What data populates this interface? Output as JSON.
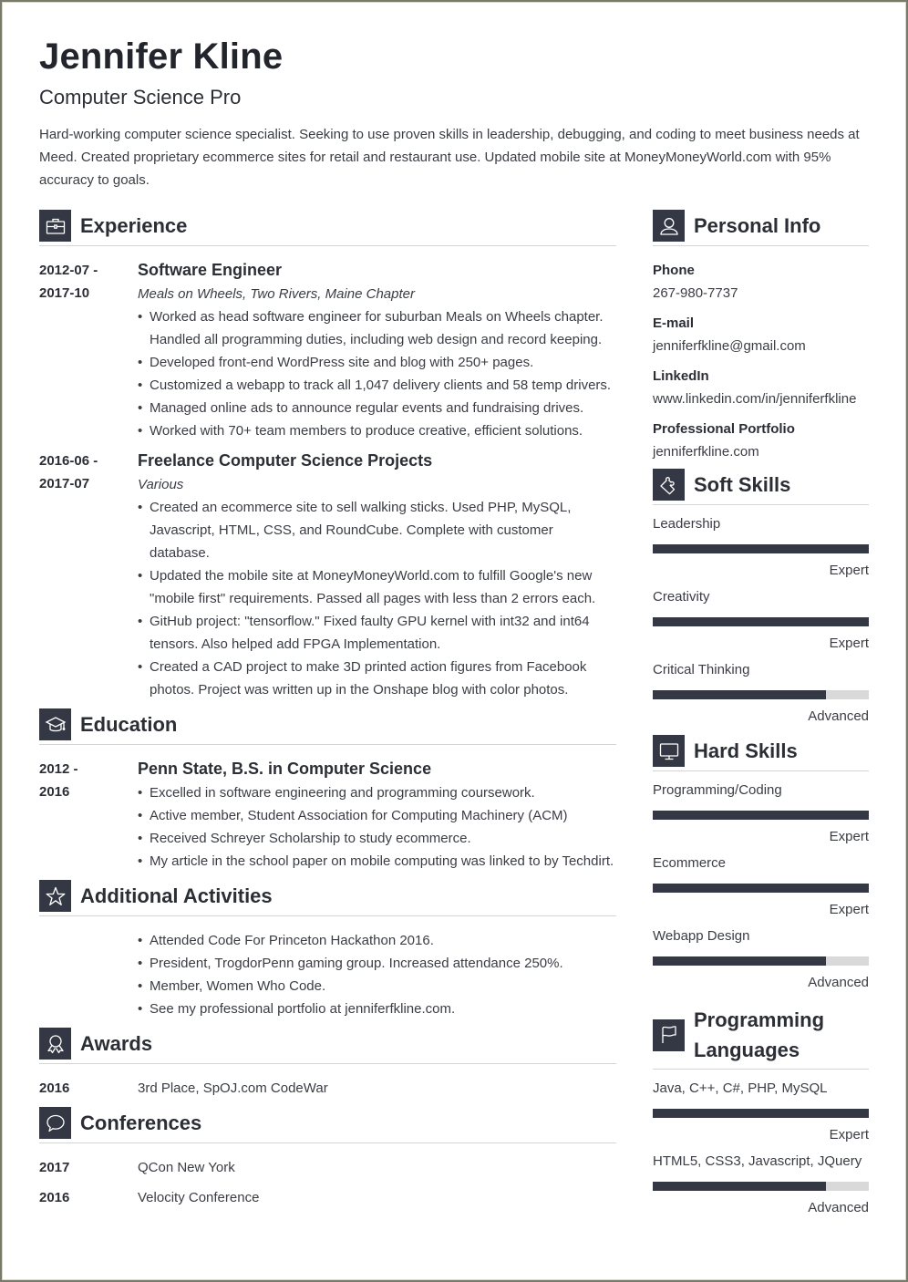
{
  "header": {
    "name": "Jennifer Kline",
    "title": "Computer Science Pro",
    "summary": "Hard-working computer science specialist. Seeking to use proven skills in leadership, debugging, and coding to meet business needs at Meed. Created proprietary ecommerce sites for retail and restaurant use. Updated mobile site at MoneyMoneyWorld.com with 95% accuracy to goals."
  },
  "colors": {
    "accent": "#333844",
    "bar_track": "#d9d9d9",
    "divider": "#d4d4d4",
    "frame": "#7a7a6a"
  },
  "experience": {
    "heading": "Experience",
    "icon": "briefcase-icon",
    "entries": [
      {
        "date_start": "2012-07 -",
        "date_end": "2017-10",
        "title": "Software Engineer",
        "org": "Meals on Wheels, Two Rivers, Maine Chapter",
        "bullets": [
          "Worked as head software engineer for suburban Meals on Wheels chapter. Handled all programming duties, including web design and record keeping.",
          "Developed front-end WordPress site and blog with 250+ pages.",
          "Customized a webapp to track all 1,047 delivery clients and 58 temp drivers.",
          "Managed online ads to announce regular events and fundraising drives.",
          "Worked with 70+ team members to produce creative, efficient solutions."
        ]
      },
      {
        "date_start": "2016-06 -",
        "date_end": "2017-07",
        "title": "Freelance Computer Science Projects",
        "org": "Various",
        "bullets": [
          "Created an ecommerce site to sell walking sticks. Used PHP, MySQL, Javascript, HTML, CSS, and RoundCube. Complete with customer database.",
          "Updated the mobile site at MoneyMoneyWorld.com to fulfill Google's new \"mobile first\" requirements. Passed all pages with less than 2 errors each.",
          "GitHub project: \"tensorflow.\" Fixed faulty GPU kernel with int32 and int64 tensors. Also helped add FPGA Implementation.",
          "Created a CAD project to make 3D printed action figures from Facebook photos. Project was written up in the Onshape blog with color photos."
        ]
      }
    ]
  },
  "education": {
    "heading": "Education",
    "icon": "graduation-cap-icon",
    "entries": [
      {
        "date_start": "2012 -",
        "date_end": "2016",
        "title": "Penn State, B.S. in Computer Science",
        "bullets": [
          "Excelled in software engineering and programming coursework.",
          "Active member, Student Association for Computing Machinery (ACM)",
          "Received Schreyer Scholarship to study ecommerce.",
          "My article in the school paper on mobile computing was linked to by Techdirt."
        ]
      }
    ]
  },
  "activities": {
    "heading": "Additional Activities",
    "icon": "star-icon",
    "bullets": [
      "Attended Code For Princeton Hackathon 2016.",
      "President, TrogdorPenn gaming group. Increased attendance 250%.",
      "Member, Women Who Code.",
      "See my professional portfolio at jenniferfkline.com."
    ]
  },
  "awards": {
    "heading": "Awards",
    "icon": "award-ribbon-icon",
    "items": [
      {
        "year": "2016",
        "text": "3rd Place, SpOJ.com CodeWar"
      }
    ]
  },
  "conferences": {
    "heading": "Conferences",
    "icon": "speech-bubble-icon",
    "items": [
      {
        "year": "2017",
        "text": "QCon New York"
      },
      {
        "year": "2016",
        "text": "Velocity Conference"
      }
    ]
  },
  "personal_info": {
    "heading": "Personal Info",
    "icon": "user-icon",
    "fields": [
      {
        "label": "Phone",
        "value": "267-980-7737"
      },
      {
        "label": "E-mail",
        "value": "jenniferfkline@gmail.com"
      },
      {
        "label": "LinkedIn",
        "value": "www.linkedin.com/in/jenniferfkline"
      },
      {
        "label": "Professional Portfolio",
        "value": "jenniferfkline.com"
      }
    ]
  },
  "soft_skills": {
    "heading": "Soft Skills",
    "icon": "puzzle-icon",
    "items": [
      {
        "name": "Leadership",
        "level": "Expert",
        "fill_percent": 100
      },
      {
        "name": "Creativity",
        "level": "Expert",
        "fill_percent": 100
      },
      {
        "name": "Critical Thinking",
        "level": "Advanced",
        "fill_percent": 80
      }
    ]
  },
  "hard_skills": {
    "heading": "Hard Skills",
    "icon": "monitor-icon",
    "items": [
      {
        "name": "Programming/Coding",
        "level": "Expert",
        "fill_percent": 100
      },
      {
        "name": "Ecommerce",
        "level": "Expert",
        "fill_percent": 100
      },
      {
        "name": "Webapp Design",
        "level": "Advanced",
        "fill_percent": 80
      }
    ]
  },
  "programming_languages": {
    "heading_line1": "Programming",
    "heading_line2": "Languages",
    "icon": "flag-icon",
    "items": [
      {
        "name": "Java, C++, C#, PHP, MySQL",
        "level": "Expert",
        "fill_percent": 100
      },
      {
        "name": "HTML5, CSS3, Javascript, JQuery",
        "level": "Advanced",
        "fill_percent": 80
      }
    ]
  }
}
